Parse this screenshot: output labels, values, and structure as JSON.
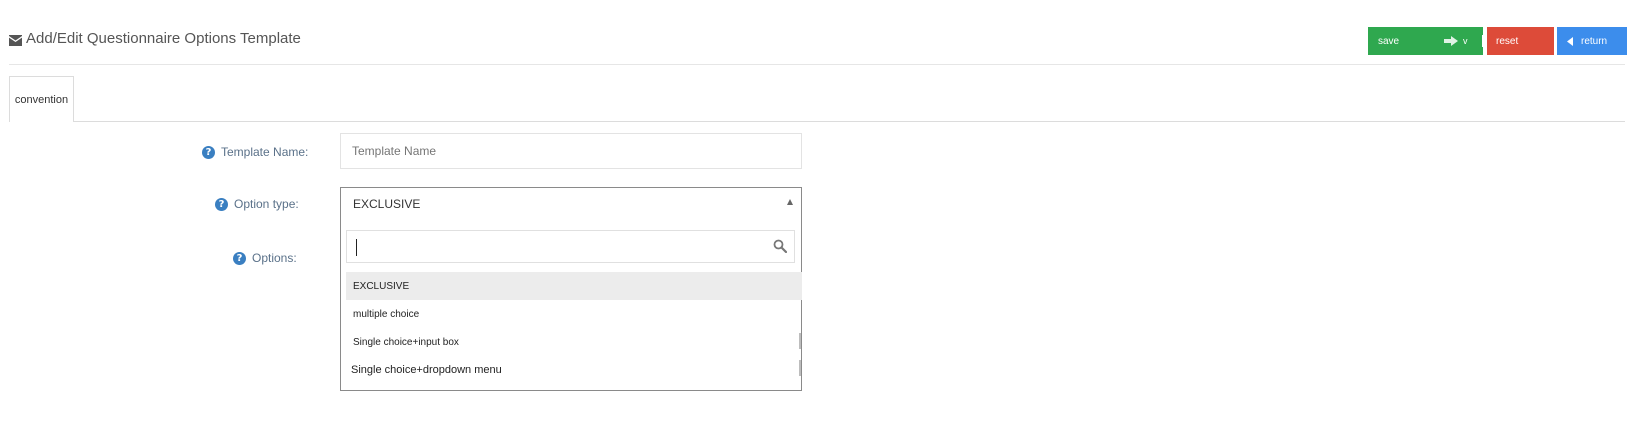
{
  "header": {
    "title": "Add/Edit Questionnaire Options Template",
    "title_icon": "envelope-icon"
  },
  "actions": {
    "save_label": "save",
    "save_extra": "v",
    "reset_label": "reset",
    "return_label": "return",
    "colors": {
      "save": "#2fa84f",
      "reset": "#dd4b39",
      "return": "#3c8dec"
    }
  },
  "tabs": [
    {
      "label": "convention",
      "active": true
    }
  ],
  "form": {
    "template_name": {
      "label": "Template Name:",
      "placeholder": "Template Name",
      "value": ""
    },
    "option_type": {
      "label": "Option type:",
      "selected": "EXCLUSIVE",
      "search_value": "",
      "options": [
        "EXCLUSIVE",
        "multiple choice",
        "Single choice+input box",
        "Single choice+dropdown menu"
      ]
    },
    "options": {
      "label": "Options:"
    }
  },
  "accent_color": "#3a7fc1"
}
